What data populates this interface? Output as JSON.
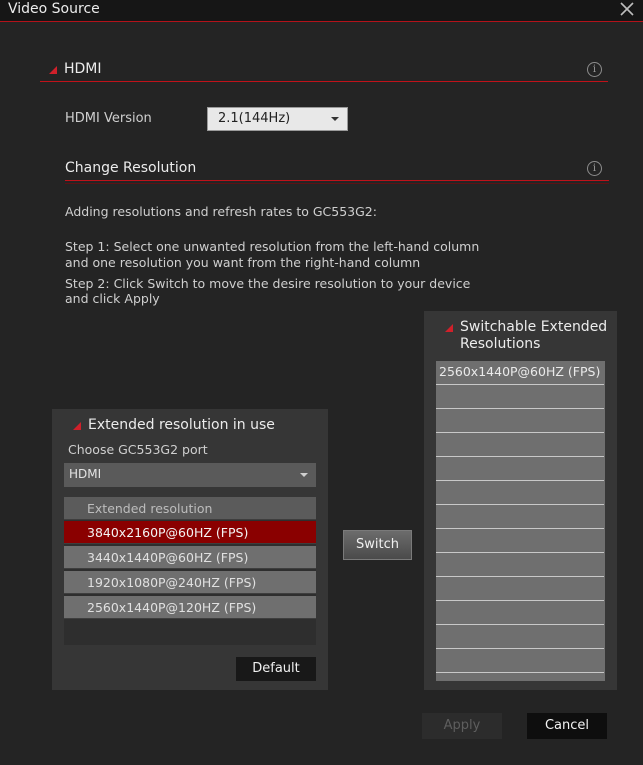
{
  "window": {
    "title": "Video Source"
  },
  "hdmi_section": {
    "title": "HDMI",
    "info_glyph": "i"
  },
  "hdmi_version": {
    "label": "HDMI Version",
    "value": "2.1(144Hz)"
  },
  "change_resolution": {
    "title": "Change Resolution",
    "info_glyph": "i"
  },
  "instructions": {
    "intro": "Adding resolutions and refresh rates to GC553G2:",
    "step1_line1": "Step 1: Select one unwanted resolution from the left-hand column",
    "step1_line2": "and one resolution you want from the right-hand column",
    "step2_line1": "Step 2: Click Switch to move the desire resolution to your device",
    "step2_line2": "and click Apply"
  },
  "left_panel": {
    "title": "Extended resolution in use",
    "port_label": "Choose GC553G2 port",
    "port_value": "HDMI",
    "list_header": "Extended resolution",
    "items": [
      {
        "label": "3840x2160P@60HZ (FPS)",
        "selected": true
      },
      {
        "label": "3440x1440P@60HZ (FPS)",
        "selected": false
      },
      {
        "label": "1920x1080P@240HZ (FPS)",
        "selected": false
      },
      {
        "label": "2560x1440P@120HZ (FPS)",
        "selected": false
      }
    ],
    "default_label": "Default"
  },
  "switch_label": "Switch",
  "right_panel": {
    "title_line1": "Switchable Extended",
    "title_line2": "Resolutions",
    "items": [
      "2560x1440P@60HZ (FPS)"
    ]
  },
  "footer": {
    "apply_label": "Apply",
    "cancel_label": "Cancel"
  },
  "colors": {
    "accent": "#c0121a",
    "selected_row": "#8a0000",
    "background": "#242424"
  }
}
